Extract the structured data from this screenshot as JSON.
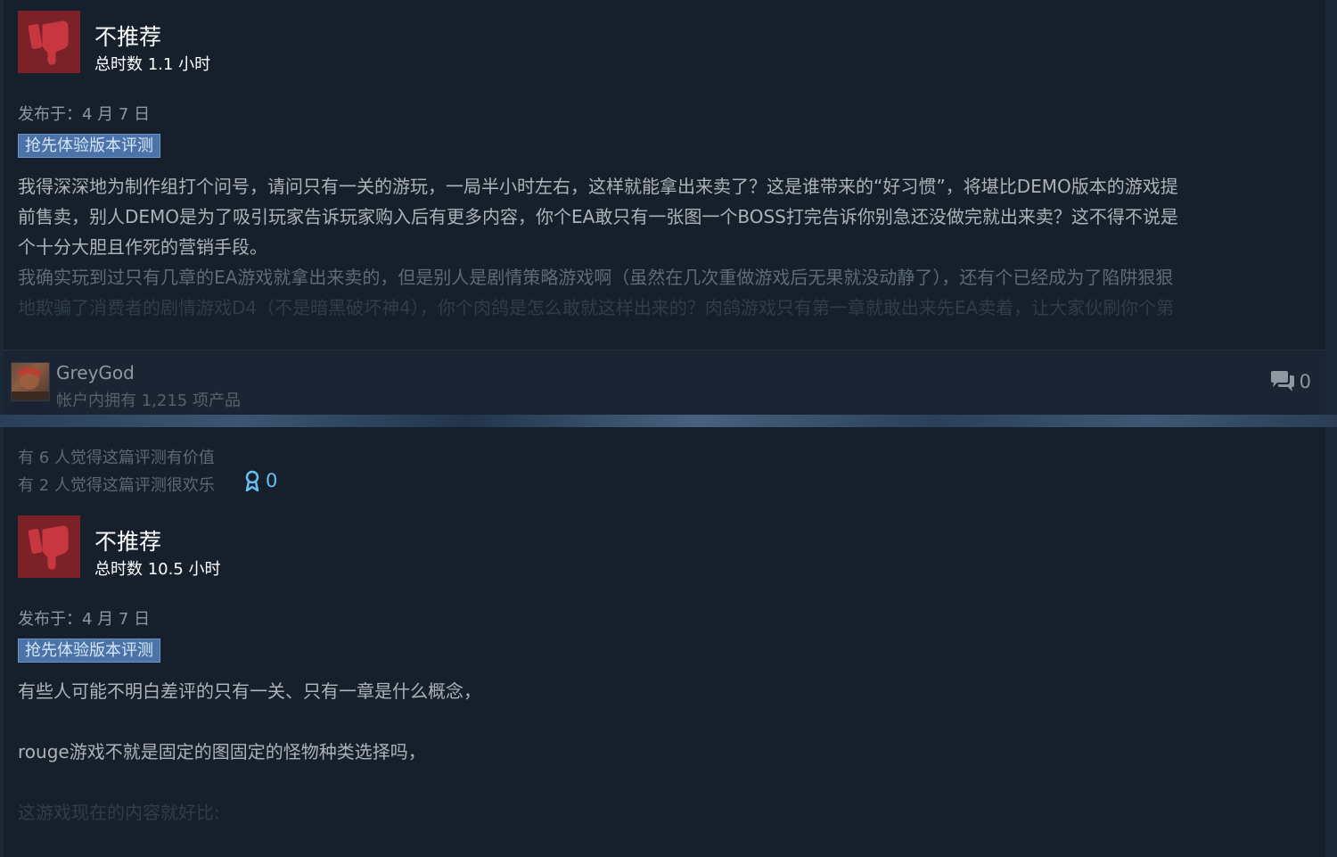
{
  "review1": {
    "recommendation": "不推荐",
    "hours": "总时数 1.1 小时",
    "posted": "发布于：4 月 7 日",
    "badge": "抢先体验版本评测",
    "paragraphs": [
      "我得深深地为制作组打个问号，请问只有一关的游玩，一局半小时左右，这样就能拿出来卖了？这是谁带来的“好习惯”，将堪比DEMO版本的游戏提",
      "前售卖，别人DEMO是为了吸引玩家告诉玩家购入后有更多内容，你个EA敢只有一张图一个BOSS打完告诉你别急还没做完就出来卖？这不得不说是",
      "个十分大胆且作死的营销手段。",
      "我确实玩到过只有几章的EA游戏就拿出来卖的，但是别人是剧情策略游戏啊（虽然在几次重做游戏后无果就没动静了），还有个已经成为了陷阱狠狠",
      "地欺骗了消费者的剧情游戏D4（不是暗黑破坏神4），你个肉鸽是怎么敢就这样出来的？肉鸽游戏只有第一章就敢出来先EA卖着，让大家伙刷你个第"
    ],
    "author": {
      "name": "GreyGod",
      "products": "帐户内拥有 1,215 项产品"
    },
    "comment_count": "0"
  },
  "review2": {
    "helpful": "有 6 人觉得这篇评测有价值",
    "funny": "有 2 人觉得这篇评测很欢乐",
    "award_count": "0",
    "recommendation": "不推荐",
    "hours": "总时数 10.5 小时",
    "posted": "发布于：4 月 7 日",
    "badge": "抢先体验版本评测",
    "paragraphs": [
      "有些人可能不明白差评的只有一关、只有一章是什么概念，",
      "rouge游戏不就是固定的图固定的怪物种类选择吗，",
      "这游戏现在的内容就好比:"
    ]
  },
  "colors": {
    "page_bg": "#1b2838",
    "card_bg": "#16202d",
    "thumb_red": "#7a2227",
    "badge_blue": "#4c73a7",
    "award_blue": "#66c0f4",
    "body_text": "#acb2b8"
  },
  "icons": {
    "thumb": "thumbs-down-icon",
    "comments": "comment-bubble-icon",
    "award": "award-ribbon-icon"
  }
}
